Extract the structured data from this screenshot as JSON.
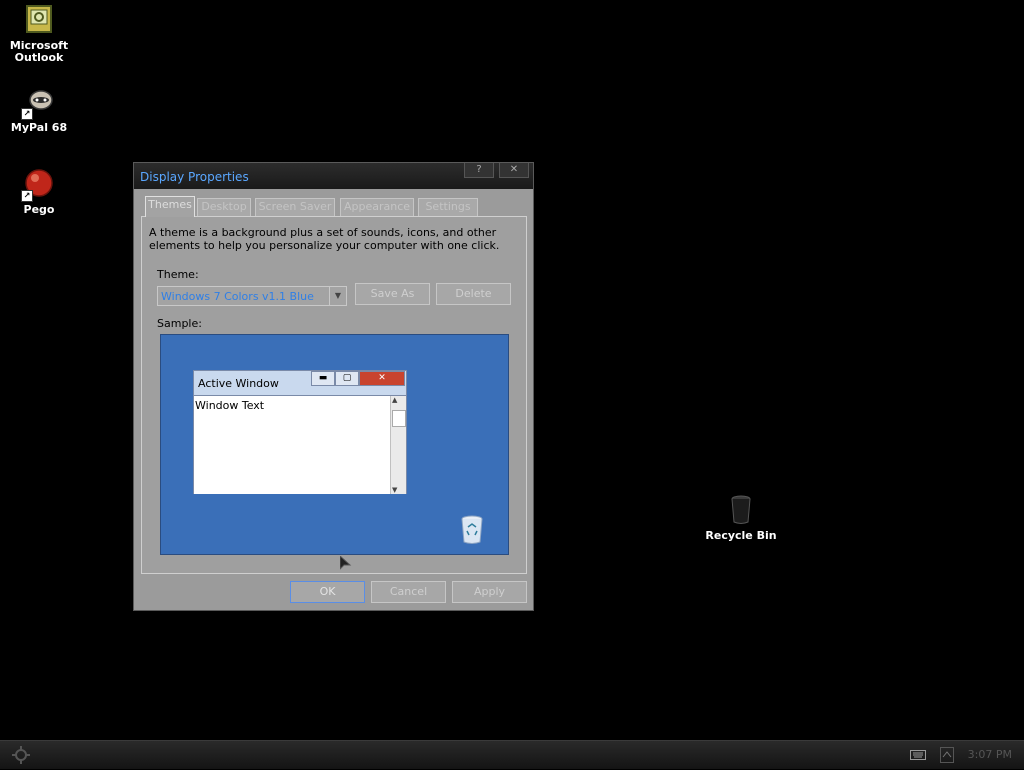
{
  "desktop": {
    "icons": [
      {
        "label_line1": "Microsoft",
        "label_line2": "Outlook",
        "icon": "outlook-icon"
      },
      {
        "label": "MyPal 68",
        "icon": "mypal-icon"
      },
      {
        "label": "Pego",
        "icon": "pego-icon"
      },
      {
        "label": "Recycle Bin",
        "icon": "recycle-bin-icon"
      }
    ]
  },
  "dialog": {
    "title": "Display Properties",
    "help_button": "?",
    "close_button": "✕",
    "tabs": [
      "Themes",
      "Desktop",
      "Screen Saver",
      "Appearance",
      "Settings"
    ],
    "description": "A theme is a background plus a set of sounds, icons, and other elements to help you personalize your computer with one click.",
    "theme_label": "Theme:",
    "theme_value": "Windows 7 Colors v1.1 Blue",
    "save_as_label": "Save As",
    "delete_label": "Delete",
    "sample_label": "Sample:",
    "sample": {
      "window_title": "Active Window",
      "window_text": "Window Text"
    },
    "ok_label": "OK",
    "cancel_label": "Cancel",
    "apply_label": "Apply"
  },
  "taskbar": {
    "clock": "3:07 PM"
  },
  "colors": {
    "title_text": "#5aa7ff",
    "sample_bg": "#3a6fb8",
    "desktop_bg": "#000000"
  }
}
